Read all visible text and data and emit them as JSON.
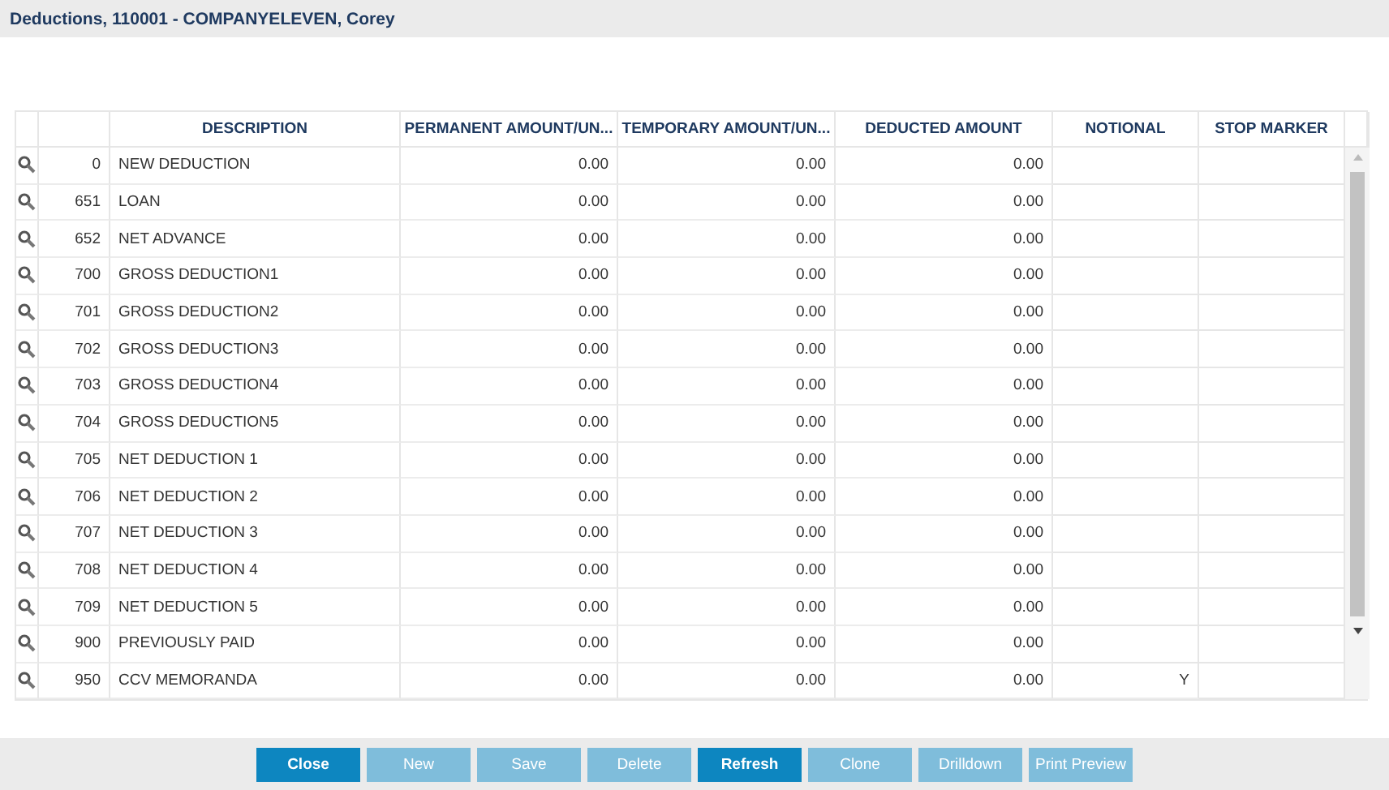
{
  "window": {
    "title": "Deductions, 110001 - COMPANYELEVEN, Corey"
  },
  "table": {
    "columns": [
      "DESCRIPTION",
      "PERMANENT AMOUNT/UN...",
      "TEMPORARY AMOUNT/UN...",
      "DEDUCTED AMOUNT",
      "NOTIONAL",
      "STOP MARKER"
    ],
    "rows": [
      {
        "code": "0",
        "description": "NEW DEDUCTION",
        "permanent": "0.00",
        "temporary": "0.00",
        "deducted": "0.00"
      },
      {
        "code": "651",
        "description": "LOAN",
        "permanent": "0.00",
        "temporary": "0.00",
        "deducted": "0.00"
      },
      {
        "code": "652",
        "description": "NET ADVANCE",
        "permanent": "0.00",
        "temporary": "0.00",
        "deducted": "0.00"
      },
      {
        "code": "700",
        "description": "GROSS DEDUCTION1",
        "permanent": "0.00",
        "temporary": "0.00",
        "deducted": "0.00"
      },
      {
        "code": "701",
        "description": "GROSS DEDUCTION2",
        "permanent": "0.00",
        "temporary": "0.00",
        "deducted": "0.00"
      },
      {
        "code": "702",
        "description": "GROSS DEDUCTION3",
        "permanent": "0.00",
        "temporary": "0.00",
        "deducted": "0.00"
      },
      {
        "code": "703",
        "description": "GROSS DEDUCTION4",
        "permanent": "0.00",
        "temporary": "0.00",
        "deducted": "0.00"
      },
      {
        "code": "704",
        "description": "GROSS DEDUCTION5",
        "permanent": "0.00",
        "temporary": "0.00",
        "deducted": "0.00"
      },
      {
        "code": "705",
        "description": "NET DEDUCTION 1",
        "permanent": "0.00",
        "temporary": "0.00",
        "deducted": "0.00"
      },
      {
        "code": "706",
        "description": "NET DEDUCTION 2",
        "permanent": "0.00",
        "temporary": "0.00",
        "deducted": "0.00"
      },
      {
        "code": "707",
        "description": "NET DEDUCTION 3",
        "permanent": "0.00",
        "temporary": "0.00",
        "deducted": "0.00"
      },
      {
        "code": "708",
        "description": "NET DEDUCTION 4",
        "permanent": "0.00",
        "temporary": "0.00",
        "deducted": "0.00"
      },
      {
        "code": "709",
        "description": "NET DEDUCTION 5",
        "permanent": "0.00",
        "temporary": "0.00",
        "deducted": "0.00"
      },
      {
        "code": "900",
        "description": "PREVIOUSLY PAID",
        "permanent": "0.00",
        "temporary": "0.00",
        "deducted": "0.00"
      },
      {
        "code": "950",
        "description": "CCV MEMORANDA",
        "permanent": "0.00",
        "temporary": "0.00",
        "deducted": "0.00",
        "notional": "Y"
      }
    ]
  },
  "buttons": [
    {
      "label": "Close",
      "disabled": false
    },
    {
      "label": "New",
      "disabled": true
    },
    {
      "label": "Save",
      "disabled": true
    },
    {
      "label": "Delete",
      "disabled": true
    },
    {
      "label": "Refresh",
      "disabled": false
    },
    {
      "label": "Clone",
      "disabled": true
    },
    {
      "label": "Drilldown",
      "disabled": true
    },
    {
      "label": "Print Preview",
      "disabled": true
    }
  ]
}
